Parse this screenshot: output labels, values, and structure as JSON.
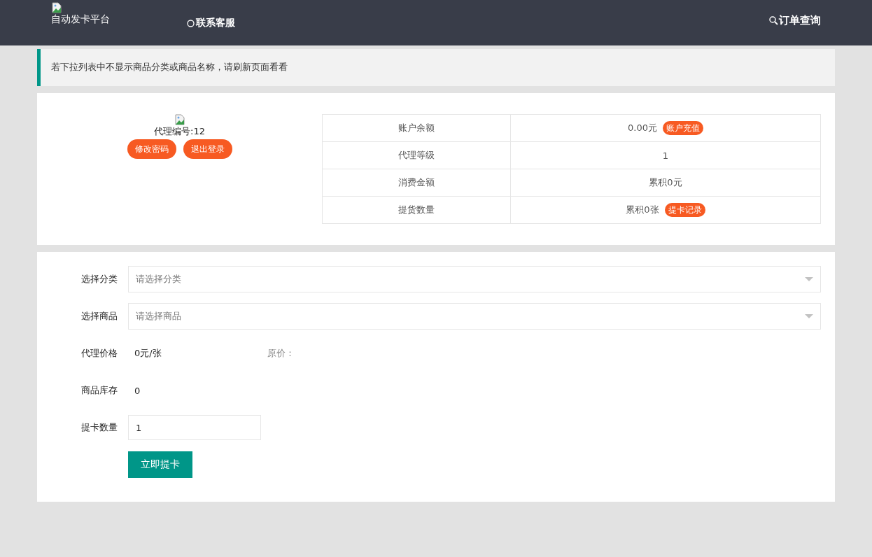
{
  "header": {
    "logo_text": "自动发卡平台",
    "contact": "联系客服",
    "order_query": "订单查询"
  },
  "notice": "若下拉列表中不显示商品分类或商品名称，请刷新页面看看",
  "agent": {
    "id_label": "代理编号:12",
    "buttons": [
      "修改密码",
      "退出登录"
    ]
  },
  "account_table": [
    {
      "label": "账户余额",
      "value": "0.00元",
      "action": "账户充值"
    },
    {
      "label": "代理等级",
      "value": "1"
    },
    {
      "label": "消费金额",
      "value": "累积0元"
    },
    {
      "label": "提货数量",
      "value": "累积0张",
      "action": "提卡记录"
    }
  ],
  "form": {
    "rows": [
      {
        "kind": "select",
        "label": "选择分类",
        "placeholder": "请选择分类"
      },
      {
        "kind": "select",
        "label": "选择商品",
        "placeholder": "请选择商品"
      },
      {
        "kind": "text",
        "label": "代理价格",
        "value": "0元/张",
        "extra": "原价："
      },
      {
        "kind": "text",
        "label": "商品库存",
        "value": "0"
      },
      {
        "kind": "input",
        "label": "提卡数量",
        "value": "1"
      }
    ],
    "submit": "立即提卡"
  }
}
